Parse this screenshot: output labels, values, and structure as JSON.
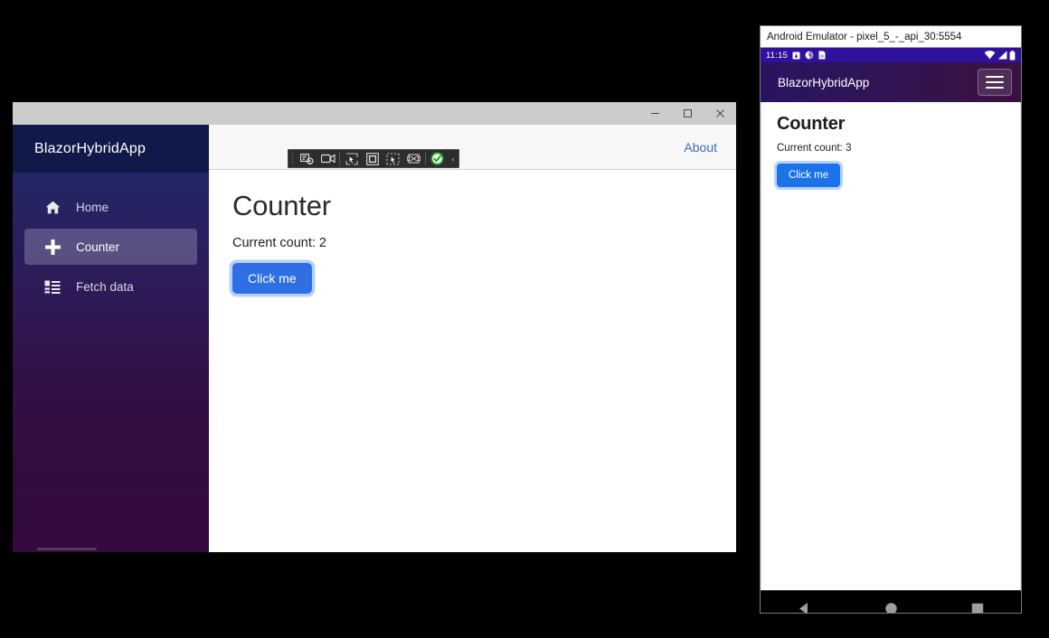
{
  "desktop_window": {
    "title_bar": {
      "minimize_label": "Minimize",
      "maximize_label": "Maximize",
      "close_label": "Close"
    },
    "sidebar": {
      "brand": "BlazorHybridApp",
      "items": [
        {
          "label": "Home",
          "icon": "home-icon",
          "active": false
        },
        {
          "label": "Counter",
          "icon": "plus-icon",
          "active": true
        },
        {
          "label": "Fetch data",
          "icon": "list-icon",
          "active": false
        }
      ]
    },
    "top_row": {
      "about_label": "About"
    },
    "vs_toolbar": {
      "buttons": [
        "hot-reload-icon",
        "live-preview-camera-icon",
        "select-element-icon",
        "display-frame-icon",
        "move-element-icon",
        "xaml-live-tree-icon",
        "hot-reload-status-ok-icon"
      ],
      "collapse_label": "‹"
    },
    "page": {
      "title": "Counter",
      "count_label": "Current count: 2",
      "button_label": "Click me"
    }
  },
  "android_emulator": {
    "window_title": "Android Emulator - pixel_5_-_api_30:5554",
    "status_bar": {
      "time": "11:15",
      "left_icons": [
        "alarm-icon",
        "clock-icon",
        "sim-card-icon"
      ],
      "right_icons": [
        "wifi-icon",
        "signal-icon",
        "battery-icon"
      ]
    },
    "app_bar": {
      "brand": "BlazorHybridApp",
      "menu_label": "Menu"
    },
    "page": {
      "title": "Counter",
      "count_label": "Current count: 3",
      "button_label": "Click me"
    },
    "nav_bar": {
      "back_label": "Back",
      "home_label": "Home",
      "recents_label": "Recent apps"
    }
  },
  "colors": {
    "blazor_brand_bar": "#101a4a",
    "sidebar_gradient_start": "#1b2a6b",
    "sidebar_gradient_end": "#350a3e",
    "primary_button": "#2f6fe4",
    "android_primary_button": "#1a73e8",
    "android_status_bar": "#30119b",
    "link": "#3b6bbf",
    "desktop_titlebar": "#cccccc",
    "page_background": "#000000"
  }
}
